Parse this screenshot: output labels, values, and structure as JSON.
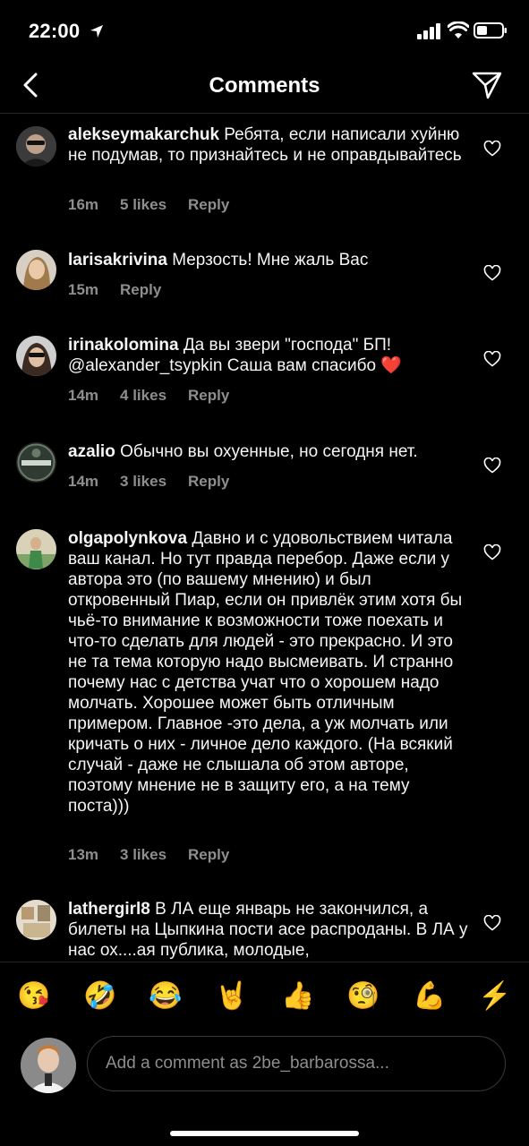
{
  "status": {
    "time": "22:00"
  },
  "header": {
    "title": "Comments"
  },
  "comments": [
    {
      "user": "alekseymakarchuk",
      "text": "Ребята, если написали хуйню не подумав, то признайтесь и не оправдывайтесь",
      "time": "16m",
      "likes": "5 likes",
      "reply": "Reply"
    },
    {
      "user": "larisakrivina",
      "text": "Мерзость! Мне жаль Вас",
      "time": "15m",
      "likes": "",
      "reply": "Reply"
    },
    {
      "user": "irinakolomina",
      "text": "Да вы звери \"господа\" БП! @alexander_tsypkin Саша вам спасибо ❤️",
      "time": "14m",
      "likes": "4 likes",
      "reply": "Reply"
    },
    {
      "user": "azalio",
      "text": "Обычно вы охуенные, но сегодня нет.",
      "time": "14m",
      "likes": "3 likes",
      "reply": "Reply"
    },
    {
      "user": "olgapolynkova",
      "text": "Давно и с удовольствием читала ваш канал. Но тут правда перебор. Даже если у автора это (по вашему мнению) и был откровенный Пиар, если он привлёк этим хотя бы чьё-то внимание к возможности тоже поехать и что-то сделать для людей - это прекрасно. И это не та тема которую надо высмеивать. И странно почему нас с детства учат что о хорошем надо молчать. Хорошее может быть отличным примером. Главное -это дела, а уж молчать или кричать о них - личное дело каждого. (На всякий случай - даже не слышала об этом авторе, поэтому мнение не в защиту его, а на тему поста)))",
      "time": "13m",
      "likes": "3 likes",
      "reply": "Reply"
    },
    {
      "user": "lathergirl8",
      "text": "В ЛА еще январь не закончился, а билеты на Цыпкина пости асе распроданы. В ЛА у нас ох....ая публика, молодые,",
      "time": "",
      "likes": "",
      "reply": ""
    }
  ],
  "emoji_bar": [
    "😘",
    "🤣",
    "😂",
    "🤘",
    "👍",
    "🧐",
    "💪",
    "⚡"
  ],
  "composer": {
    "placeholder": "Add a comment as 2be_barbarossa..."
  }
}
